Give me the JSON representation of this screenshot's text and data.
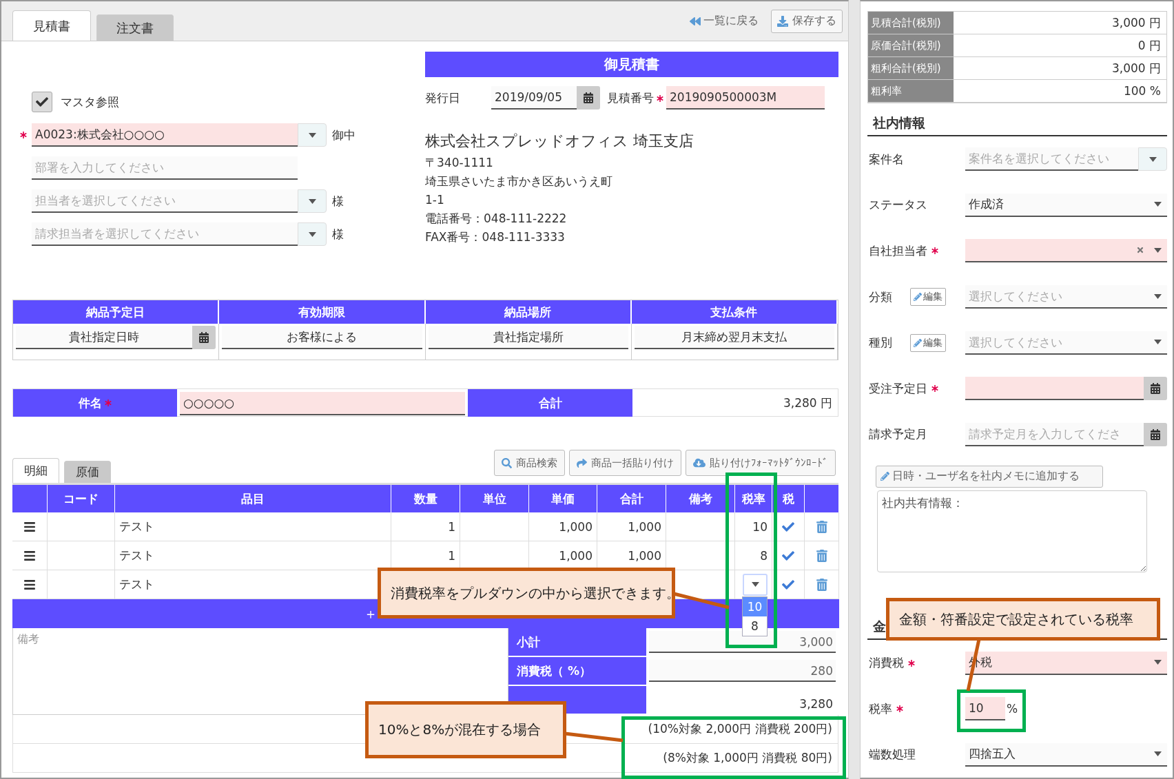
{
  "tabs": [
    {
      "label": "見積書",
      "selected": true
    },
    {
      "label": "注文書",
      "selected": false
    }
  ],
  "header_actions": [
    {
      "kind": "back",
      "label": "一覧に戻る"
    },
    {
      "kind": "save",
      "label": "保存する"
    }
  ],
  "client": {
    "master_ref": {
      "label": "マスタ参照",
      "checked": true
    },
    "fields": [
      {
        "kind": "combo",
        "value": "A0023:株式会社○○○○",
        "required": true,
        "suffix": "御中"
      },
      {
        "kind": "text",
        "placeholder": "部署を入力してください",
        "required": false
      },
      {
        "kind": "combo",
        "placeholder": "担当者を選択してください",
        "required": false,
        "suffix": "様"
      },
      {
        "kind": "combo",
        "placeholder": "請求担当者を選択してください",
        "required": false,
        "suffix": "様"
      }
    ]
  },
  "document": {
    "title": "御見積書",
    "issue_date": {
      "label": "発行日",
      "value": "2019/09/05"
    },
    "number": {
      "label": "見積番号",
      "value": "2019090500003M",
      "required": true
    },
    "issuer": [
      "株式会社スプレッドオフィス 埼玉支店",
      "〒340-1111",
      "埼玉県さいたま市かき区あいうえ町",
      "1-1",
      "電話番号：048-111-2222",
      "FAX番号：048-111-3333"
    ]
  },
  "conditions": [
    {
      "label": "納品予定日",
      "value": "貴社指定日時",
      "calendar": true
    },
    {
      "label": "有効期限",
      "value": "お客様による",
      "calendar": false
    },
    {
      "label": "納品場所",
      "value": "貴社指定場所",
      "calendar": false
    },
    {
      "label": "支払条件",
      "value": "月末締め翌月末支払",
      "calendar": false
    }
  ],
  "subject": {
    "label": "件名",
    "required": true,
    "value": "○○○○○",
    "total_label": "合計",
    "total_value": "3,280 円"
  },
  "detail_tabs": [
    {
      "label": "明細",
      "selected": true
    },
    {
      "label": "原価",
      "selected": false
    }
  ],
  "tools": [
    {
      "kind": "search",
      "label": "商品検索"
    },
    {
      "kind": "paste",
      "label": "商品一括貼り付け"
    },
    {
      "kind": "download",
      "label": "貼り付けﾌｫｰﾏｯﾄﾀﾞｳﾝﾛｰﾄﾞ"
    }
  ],
  "table": {
    "columns": [
      "コード",
      "品目",
      "数量",
      "単位",
      "単価",
      "合計",
      "備考",
      "税率",
      "税"
    ],
    "rows": [
      {
        "item": "テスト",
        "quantity": "1",
        "price": "1,000",
        "total": "1,000",
        "rate": {
          "kind": "text",
          "value": "10"
        },
        "taxed": true
      },
      {
        "item": "テスト",
        "quantity": "1",
        "price": "1,000",
        "total": "1,000",
        "rate": {
          "kind": "text",
          "value": "8"
        },
        "taxed": true
      },
      {
        "item": "テスト",
        "rate": {
          "kind": "select",
          "options": [
            {
              "label": "10",
              "selected": true
            },
            {
              "label": "8",
              "selected": false
            }
          ]
        },
        "taxed": true
      }
    ]
  },
  "add_row": "＋",
  "remarks_placeholder": "備考",
  "summary": [
    {
      "kind": "field",
      "label": "小計",
      "value": "3,000"
    },
    {
      "kind": "field",
      "label": "消費税（ %）",
      "value": "280"
    },
    {
      "kind": "plain",
      "value": "3,280"
    }
  ],
  "breakdown": [
    "(10%対象 2,000円 消費税 200円)",
    "(8%対象 1,000円 消費税 80円)"
  ],
  "totals": [
    {
      "label": "見積合計(税別)",
      "value": "3,000 円"
    },
    {
      "label": "原価合計(税別)",
      "value": "0 円"
    },
    {
      "label": "粗利合計(税別)",
      "value": "3,000 円"
    },
    {
      "label": "粗利率",
      "value": "100 %"
    }
  ],
  "internal": {
    "heading": "社内情報",
    "fields": [
      {
        "label": "案件名",
        "kind": "combo",
        "placeholder": "案件名を選択してください",
        "required": false
      },
      {
        "label": "ステータス",
        "kind": "select",
        "value": "作成済",
        "required": false,
        "clearable": false
      },
      {
        "label": "自社担当者",
        "kind": "select",
        "required": true,
        "clearable": true
      },
      {
        "label": "分類",
        "kind": "select",
        "edit": "編集",
        "placeholder": "選択してください",
        "required": false,
        "clearable": false
      },
      {
        "label": "種別",
        "kind": "select",
        "edit": "編集",
        "placeholder": "選択してください",
        "required": false,
        "clearable": false
      },
      {
        "label": "受注予定日",
        "kind": "date",
        "required": true
      },
      {
        "label": "請求予定月",
        "kind": "date",
        "placeholder": "請求予定月を入力してくださ",
        "required": false
      }
    ],
    "memo_button": "日時・ユーザ名を社内メモに追加する",
    "memo_text": "社内共有情報："
  },
  "amount": {
    "heading": "金",
    "fields": [
      {
        "label": "消費税",
        "kind": "select",
        "value": "外税",
        "required": true,
        "clearable": false
      },
      {
        "label": "税率",
        "kind": "percent",
        "value": "10",
        "unit": "%",
        "required": true
      },
      {
        "label": "端数処理",
        "kind": "select",
        "value": "四捨五入",
        "required": false,
        "clearable": false
      }
    ]
  },
  "callouts": [
    {
      "text": "消費税率をプルダウンの中から選択できます。"
    },
    {
      "text": "10%と8%が混在する場合"
    },
    {
      "text": "金額・符番設定で設定されている税率"
    }
  ]
}
